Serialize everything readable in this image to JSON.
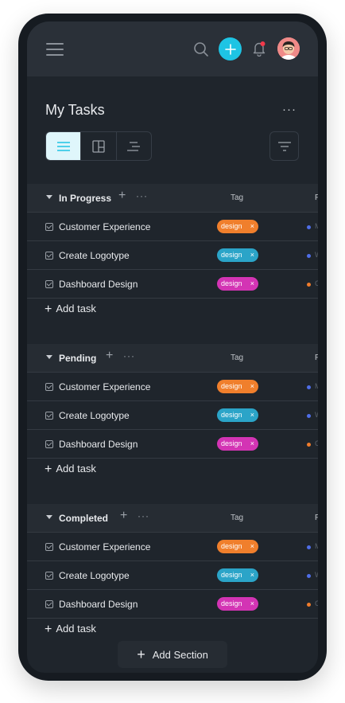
{
  "header": {
    "title": "My Tasks",
    "more": "···"
  },
  "columns": {
    "tag": "Tag",
    "priority": "P"
  },
  "colors": {
    "accent": "#1ec4e4",
    "design_orange": "#f07f2c",
    "design_blue": "#2ba4c8",
    "design_pink": "#d334b4",
    "dot_blue": "#4f6ee8",
    "dot_orange": "#ef7c2c"
  },
  "sections": [
    {
      "name": "In Progress",
      "tasks": [
        {
          "name": "Customer Experience",
          "tag": "design",
          "tag_close": "×",
          "priority_color": "#4f6ee8",
          "priority_text": "M"
        },
        {
          "name": "Create Logotype",
          "tag": "design",
          "tag_close": "×",
          "priority_color": "#4f6ee8",
          "priority_text": "W"
        },
        {
          "name": "Dashboard Design",
          "tag": "design",
          "tag_close": "×",
          "priority_color": "#ef7c2c",
          "priority_text": "C"
        }
      ],
      "add_task": "Add task"
    },
    {
      "name": "Pending",
      "tasks": [
        {
          "name": "Customer Experience",
          "tag": "design",
          "tag_close": "×",
          "priority_color": "#4f6ee8",
          "priority_text": "M"
        },
        {
          "name": "Create Logotype",
          "tag": "design",
          "tag_close": "×",
          "priority_color": "#4f6ee8",
          "priority_text": "W"
        },
        {
          "name": "Dashboard Design",
          "tag": "design",
          "tag_close": "×",
          "priority_color": "#ef7c2c",
          "priority_text": "C"
        }
      ],
      "add_task": "Add task"
    },
    {
      "name": "Completed",
      "tasks": [
        {
          "name": "Customer Experience",
          "tag": "design",
          "tag_close": "×",
          "priority_color": "#4f6ee8",
          "priority_text": "M"
        },
        {
          "name": "Create Logotype",
          "tag": "design",
          "tag_close": "×",
          "priority_color": "#4f6ee8",
          "priority_text": "W"
        },
        {
          "name": "Dashboard Design",
          "tag": "design",
          "tag_close": "×",
          "priority_color": "#ef7c2c",
          "priority_text": "C"
        }
      ],
      "add_task": "Add task"
    }
  ],
  "add_section": "Add Section",
  "icons": {
    "menu": "hamburger-menu-icon",
    "search": "search-icon",
    "add": "plus-icon",
    "notifications": "bell-icon",
    "list_view": "list-view-icon",
    "board_view": "board-view-icon",
    "timeline_view": "timeline-view-icon",
    "filter": "filter-icon"
  }
}
